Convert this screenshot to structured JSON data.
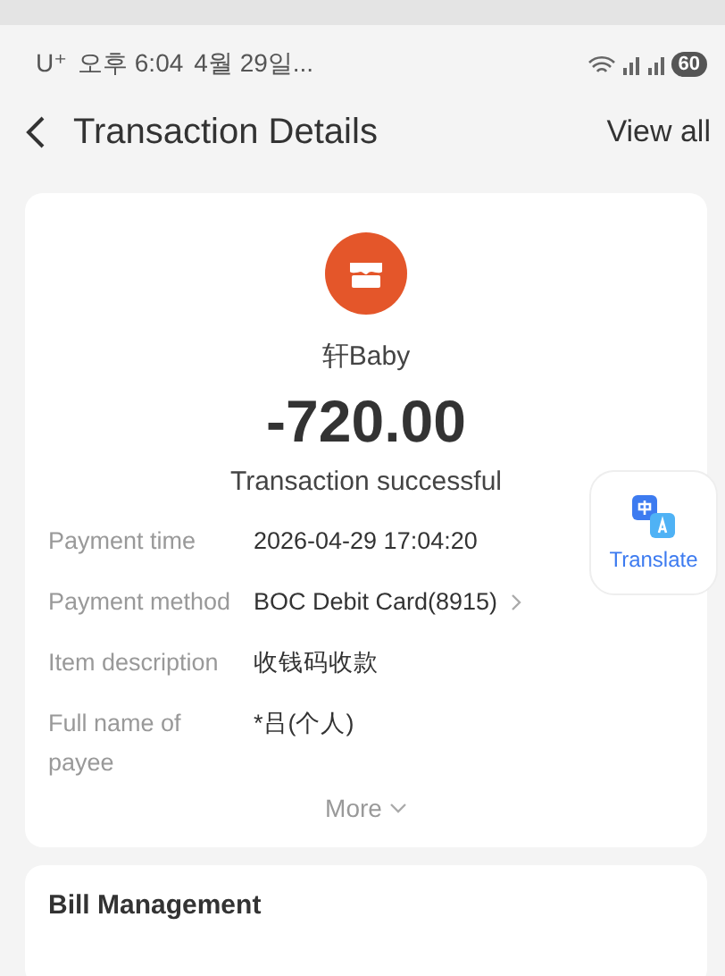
{
  "status_bar": {
    "carrier": "U⁺",
    "time": "오후 6:04",
    "date": "4월 29일...",
    "battery": "60"
  },
  "header": {
    "title": "Transaction Details",
    "action": "View all"
  },
  "summary": {
    "merchant": "轩Baby",
    "amount": "-720.00",
    "status": "Transaction successful"
  },
  "details": [
    {
      "label": "Payment time",
      "value": "2026-04-29 17:04:20",
      "link": false
    },
    {
      "label": "Payment method",
      "value": "BOC Debit Card(8915)",
      "link": true
    },
    {
      "label": "Item description",
      "value": "收钱码收款",
      "link": false
    },
    {
      "label": "Full name of payee",
      "value": "*吕(个人)",
      "link": false
    }
  ],
  "more": "More",
  "translate": {
    "label": "Translate"
  },
  "section": {
    "title": "Bill Management"
  }
}
